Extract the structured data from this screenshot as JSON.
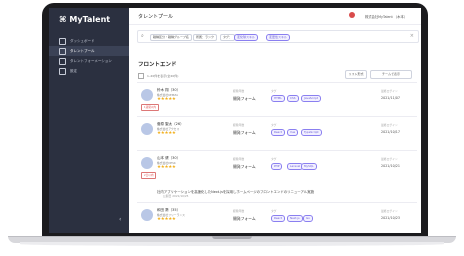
{
  "app": {
    "name": "MyTalent",
    "page_title": "タレントプール"
  },
  "sidebar": {
    "items": [
      {
        "label": "ダッシュボード",
        "icon": "grid-icon"
      },
      {
        "label": "タレントプール",
        "icon": "people-icon"
      },
      {
        "label": "タレントフォーメーション",
        "icon": "network-icon"
      },
      {
        "label": "設定",
        "icon": "gear-icon"
      }
    ],
    "collapse_glyph": "‹"
  },
  "header": {
    "user_label": "株式会社MyTalent （木本）"
  },
  "search": {
    "chips": [
      "職種区分・職種グループ名",
      "所属：ランク",
      "タグ：",
      "変化球スキル",
      "変更性スキル"
    ]
  },
  "section": {
    "title": "フロントエンド",
    "select_all": "1–20件を表示(全20件)",
    "list_button": "リスト形式",
    "team_button": "チームで表示"
  },
  "candidates": [
    {
      "name": "鈴木 翔（30）",
      "sub": "株式会社KEMZA",
      "stars": "★★★★★",
      "badge": "1週間以内",
      "col_a": "経験年数",
      "col_b": "タグ",
      "col_c": "最終ログイン",
      "skill": "開発フォーム",
      "chips": [
        "HTML",
        "CSS",
        "JavaScript"
      ],
      "date": "2021/11/07"
    },
    {
      "name": "菅原 聖太（26）",
      "sub": "株式会社アクセス",
      "stars": "★★★★★",
      "badge": "",
      "col_a": "経験年数",
      "col_b": "タグ",
      "col_c": "最終ログイン",
      "skill": "開発フォーム",
      "chips": [
        "React",
        "Vue",
        "TypeScript"
      ],
      "date": "2021/10/17"
    },
    {
      "name": "山本 健（30）",
      "sub": "株式会社DESK",
      "stars": "★★★★★",
      "badge": "2日以内",
      "col_a": "経験年数",
      "col_b": "タグ",
      "col_c": "最終ログイン",
      "skill": "開発フォーム",
      "chips": [
        "PHP",
        "Laravel",
        "MySQL"
      ],
      "date": "2021/10/21",
      "note": "社内アプリケーションを高速化したNext.jsを採用しホームページのフロントエンドのリニューアル実施",
      "note_sub": "公開日 2021/10/25"
    },
    {
      "name": "和田 葵（35）",
      "sub": "株式会社フリーランス",
      "stars": "★★★★★",
      "badge": "",
      "col_a": "経験年数",
      "col_b": "タグ",
      "col_c": "最終ログイン",
      "skill": "開発フォーム",
      "chips": [
        "React",
        "Next.js",
        "Go"
      ],
      "date": "2021/10/23"
    }
  ]
}
